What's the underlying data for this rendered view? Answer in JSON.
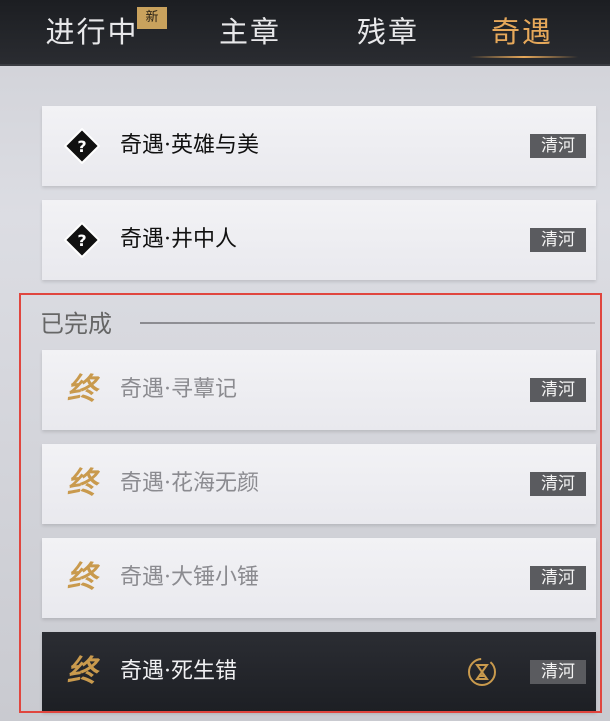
{
  "tabs": [
    {
      "label": "进行中",
      "badge": "新"
    },
    {
      "label": "主章"
    },
    {
      "label": "残章"
    },
    {
      "label": "奇遇",
      "active": true
    }
  ],
  "in_progress": [
    {
      "title": "奇遇·英雄与美",
      "region": "清河",
      "icon": "question-diamond-icon"
    },
    {
      "title": "奇遇·井中人",
      "region": "清河",
      "icon": "question-diamond-icon"
    }
  ],
  "completed_section": {
    "title": "已完成",
    "items": [
      {
        "title": "奇遇·寻蕈记",
        "region": "清河",
        "icon_text": "终"
      },
      {
        "title": "奇遇·花海无颜",
        "region": "清河",
        "icon_text": "终"
      },
      {
        "title": "奇遇·大锤小锤",
        "region": "清河",
        "icon_text": "终"
      },
      {
        "title": "奇遇·死生错",
        "region": "清河",
        "icon_text": "终",
        "extra_icon": "hourglass-icon"
      }
    ]
  },
  "colors": {
    "accent": "#e6a85a",
    "highlight_border": "#e0463f",
    "end_icon": "#c99a4d"
  }
}
